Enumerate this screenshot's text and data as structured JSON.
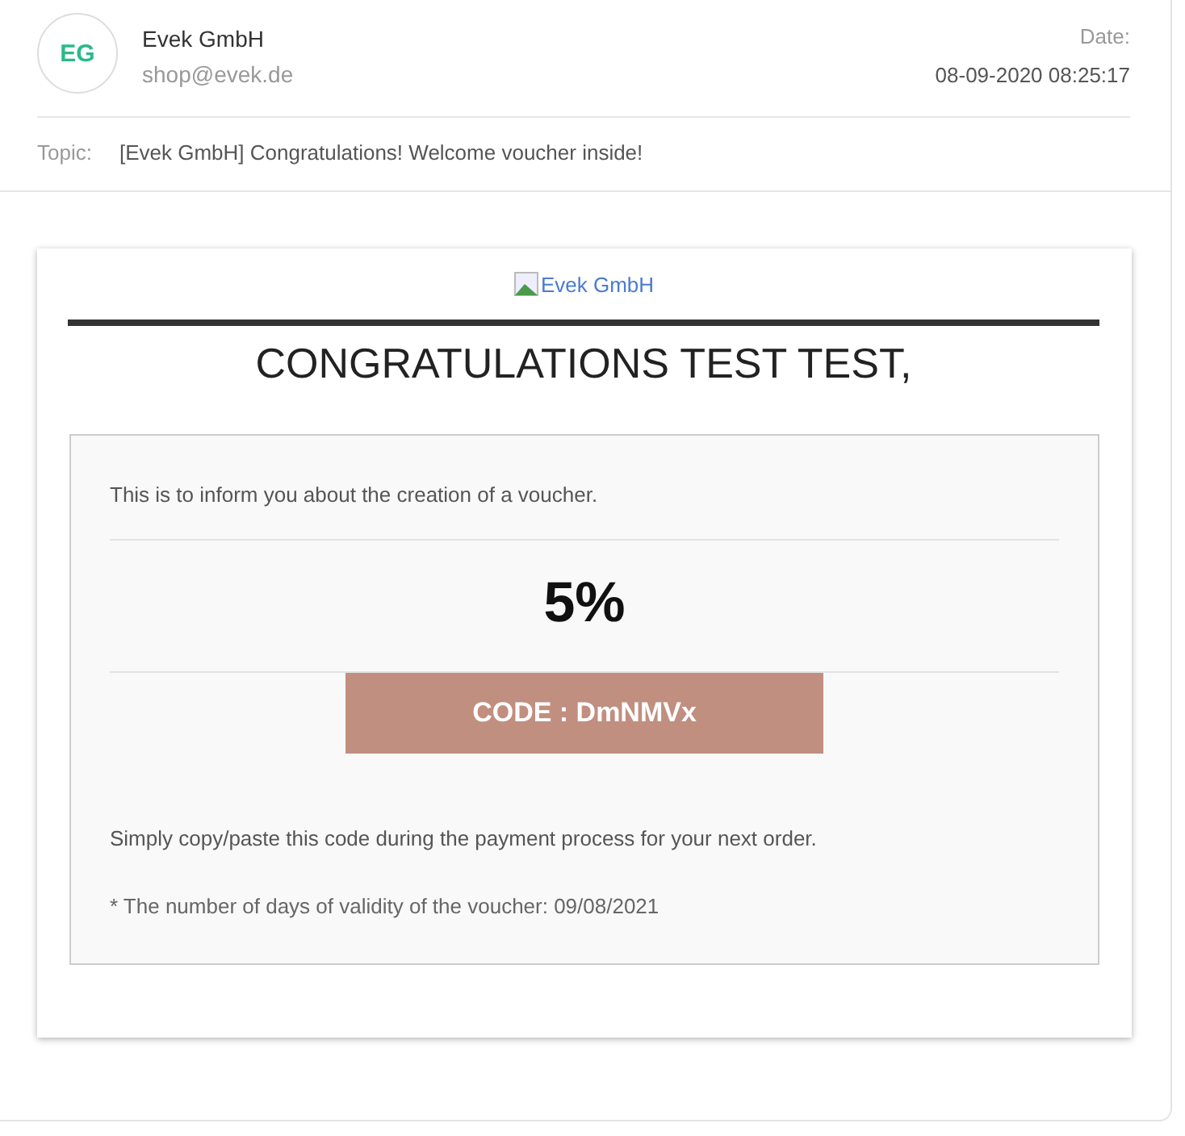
{
  "sender": {
    "initials": "EG",
    "name": "Evek GmbH",
    "email": "shop@evek.de"
  },
  "date": {
    "label": "Date:",
    "value": "08-09-2020 08:25:17"
  },
  "topic": {
    "label": "Topic:",
    "value": "[Evek GmbH] Congratulations! Welcome voucher inside!"
  },
  "email": {
    "logo_alt": "Evek GmbH",
    "heading": "CONGRATULATIONS TEST TEST,",
    "intro": "This is to inform you about the creation of a voucher.",
    "discount": "5%",
    "code": "CODE : DmNMVx",
    "instructions": "Simply copy/paste this code during the payment process for your next order.",
    "validity_note": "* The number of days of validity of the voucher: 09/08/2021"
  }
}
